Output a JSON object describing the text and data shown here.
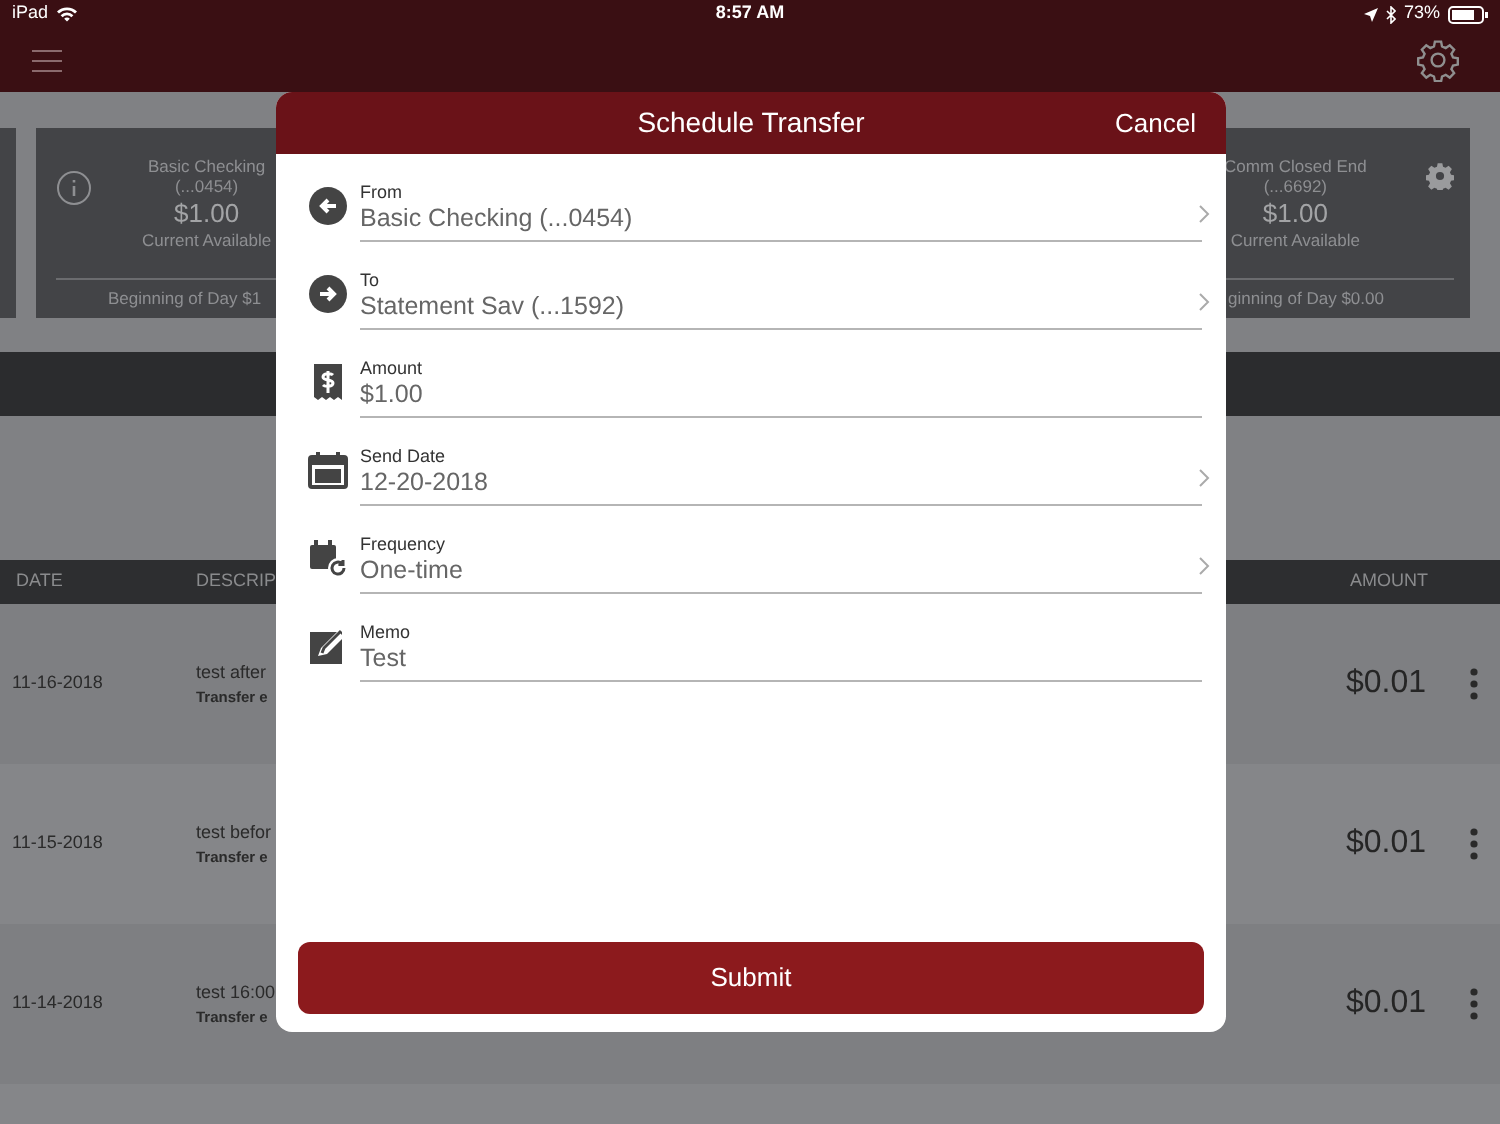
{
  "status_bar": {
    "device": "iPad",
    "time": "8:57 AM",
    "battery": "73%"
  },
  "accounts": [
    {
      "name": "Basic Checking",
      "number": "(...0454)",
      "balance": "$1.00",
      "balance_label": "Current Available",
      "beginning": "Beginning of Day $1"
    },
    {
      "name": "Comm Closed End",
      "number": "(...6692)",
      "balance": "$1.00",
      "balance_label": "Current Available",
      "beginning": "ginning of Day $0.00"
    }
  ],
  "table": {
    "columns": [
      "DATE",
      "DESCRIP",
      "AMOUNT"
    ],
    "rows": [
      {
        "date": "11-16-2018",
        "description": "test after",
        "detail": "Transfer e",
        "amount": "$0.01"
      },
      {
        "date": "11-15-2018",
        "description": "test befor",
        "detail": "Transfer e",
        "amount": "$0.01"
      },
      {
        "date": "11-14-2018",
        "description": "test 16:00",
        "detail": "Transfer e",
        "amount": "$0.01"
      }
    ]
  },
  "dialog": {
    "title": "Schedule Transfer",
    "cancel": "Cancel",
    "fields": [
      {
        "kind": "from",
        "label": "From",
        "value": "Basic Checking (...0454)",
        "chevron": true
      },
      {
        "kind": "to",
        "label": "To",
        "value": "Statement Sav (...1592)",
        "chevron": true
      },
      {
        "kind": "amount",
        "label": "Amount",
        "value": "$1.00",
        "chevron": false
      },
      {
        "kind": "date",
        "label": "Send Date",
        "value": "12-20-2018",
        "chevron": true
      },
      {
        "kind": "frequency",
        "label": "Frequency",
        "value": "One-time",
        "chevron": true
      },
      {
        "kind": "memo",
        "label": "Memo",
        "value": "Test",
        "chevron": false
      }
    ],
    "submit": "Submit"
  }
}
